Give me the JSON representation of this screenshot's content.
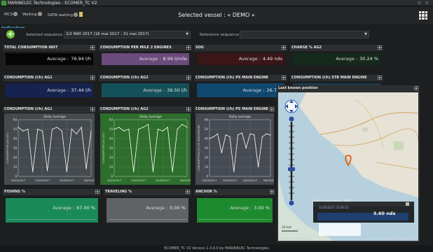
{
  "window": {
    "title": "MARINELEC Technologies - ECOMER_TC V2"
  },
  "toolbar": {
    "items": [
      {
        "label": "MCS"
      },
      {
        "label": "Waiting"
      },
      {
        "label": "DATA waiting"
      }
    ],
    "vessel_label": "Selected vessel : « DEMO »",
    "section": "Indicators"
  },
  "sequence": {
    "selected_label": "Selected sequence",
    "selected_value": "2/2 MAY 2017 (16 mai 2017 - 31 mai 2017)",
    "reference_label": "Reference sequence",
    "reference_value": ""
  },
  "tiles": [
    {
      "title": "TOTAL CONSUMPTION INST",
      "avg_label": "Average :",
      "value": "76.94 l/h",
      "color": "#050505"
    },
    {
      "title": "CONSUMPTION PER MILE 2 ENGINES",
      "avg_label": "Average :",
      "value": "8.99 l/mile",
      "color": "#6b4a7c"
    },
    {
      "title": "SOG",
      "avg_label": "Average :",
      "value": "4.49 nds",
      "color": "#3a1618"
    },
    {
      "title": "CHARGE % AG2",
      "avg_label": "Average :",
      "value": "30.24 %",
      "color": "#152a1a"
    },
    {
      "title": "CONSUMPTION (l/h) AG1",
      "avg_label": "Average :",
      "value": "37.44 l/h",
      "color": "#16234e"
    },
    {
      "title": "CONSUMPTION (l/h) AG2",
      "avg_label": "Average :",
      "value": "39.50 l/h",
      "color": "#14505a"
    },
    {
      "title": "CONSUMPTION (l/h) PS MAIN ENGINE",
      "avg_label": "Average :",
      "value": "26.77 l",
      "color": "#10476e"
    },
    {
      "title": "CONSUMPTION (l/h) STB MAIN ENGINE",
      "avg_label": "",
      "value": "",
      "color": "#1e3a4a"
    }
  ],
  "charts_panels": [
    {
      "title": "CONSUMPTION (l/h) AG1",
      "bg": "#444a4e"
    },
    {
      "title": "CONSUMPTION (l/h) AG2",
      "bg": "#2d6e2d"
    },
    {
      "title": "CONSUMPTION (l/h) PS MAIN ENGINE",
      "bg": "#464a52"
    }
  ],
  "chart_data": [
    {
      "type": "line",
      "title": "Daily average",
      "ylabel": "CONSUMPTION (l/h) AG1",
      "x": [
        "16/05/2017",
        "20/05/2017",
        "24/05/2017",
        "28/05/2017"
      ],
      "y_ticks": [
        0,
        10,
        20,
        30,
        40,
        50,
        60
      ],
      "ylim": [
        0,
        60
      ],
      "series": [
        {
          "values": [
            52,
            48,
            50,
            5,
            50,
            48,
            6,
            50,
            52,
            48,
            5,
            50,
            45,
            52,
            8,
            48
          ]
        }
      ]
    },
    {
      "type": "line",
      "title": "Daily average",
      "ylabel": "CONSUMPTION (l/h) AG2",
      "x": [
        "16/05/2017",
        "20/05/2017",
        "24/05/2017",
        "28/05/2017"
      ],
      "y_ticks": [
        0,
        10,
        20,
        30,
        40,
        50,
        60
      ],
      "ylim": [
        0,
        60
      ],
      "series": [
        {
          "values": [
            50,
            52,
            48,
            50,
            5,
            50,
            52,
            55,
            5,
            50,
            48,
            52,
            5,
            50,
            55,
            52
          ]
        }
      ]
    },
    {
      "type": "line",
      "title": "Daily average",
      "ylabel": "CONSUMPTION (l/h) PS MAIN ENGINE",
      "x": [
        "16/05/2017",
        "20/05/2017",
        "24/05/2017",
        "28/05/2017"
      ],
      "y_ticks": [
        0,
        10,
        20,
        30,
        40,
        50,
        60
      ],
      "ylim": [
        0,
        60
      ],
      "series": [
        {
          "values": [
            40,
            42,
            45,
            25,
            44,
            42,
            5,
            44,
            46,
            30,
            45,
            44,
            10,
            42,
            45,
            44
          ]
        }
      ]
    }
  ],
  "bottom_tiles": [
    {
      "title": "FISHING %",
      "avg_label": "Average :",
      "value": "67.00 %",
      "color": "#1b8a5a"
    },
    {
      "title": "TRAVELING %",
      "avg_label": "Average :",
      "value": "0.00 %",
      "color": "#5f6366"
    },
    {
      "title": "ANCHOR %",
      "avg_label": "Average :",
      "value": "3.00 %",
      "color": "#1e8a2e"
    }
  ],
  "map": {
    "title": "Last known position",
    "scale_label": "31 km",
    "coords": "50°52'23 N - 01°52'59 E",
    "date": "31/05/2017 23:59:53",
    "popup": {
      "title": "Last known value : SOG",
      "date": "31/05/2017 23:59:53",
      "value": "5.60 nds"
    }
  },
  "status": {
    "text": "ECOMER_TC V2 Version 1.3.0.0 by MARINELEC Technologies"
  }
}
